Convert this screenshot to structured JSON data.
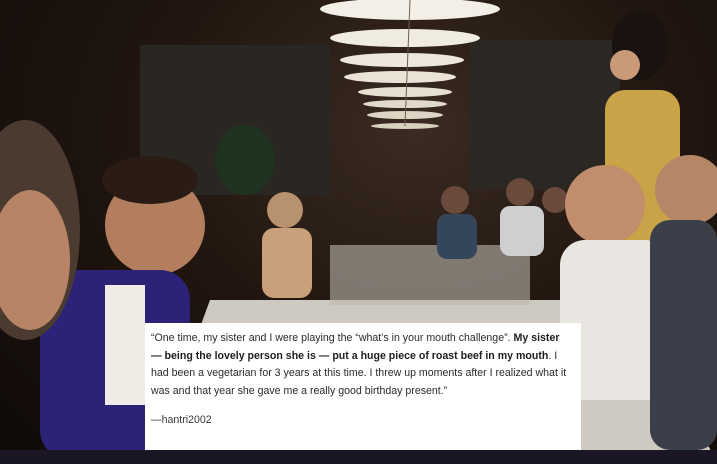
{
  "caption": {
    "quote_part1": "“One time, my sister and I were playing the “what’s in your mouth challenge”.",
    "quote_bold": "My sister — being the lovely person she is — put a huge piece of roast beef in my mouth",
    "quote_part2": ". I had been a vegetarian for 3 years at this time. I threw up moments after I realized what it was and that year she gave me a really good birthday present.”",
    "attribution": "—hantri2002"
  },
  "photo": {
    "subject": "dinner-party-table",
    "palette": {
      "background": "#21160f",
      "lamp": "#f4efe6",
      "tablecloth": "#d8d4cc",
      "caption_bg": "#ffffff",
      "bar": "#1a1626"
    }
  }
}
